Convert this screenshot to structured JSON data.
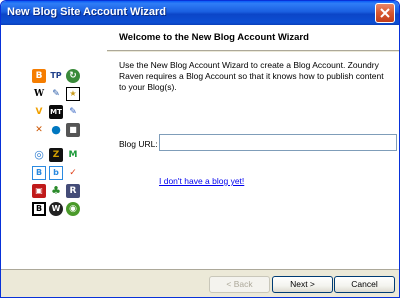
{
  "window": {
    "title": "New Blog Site Account Wizard",
    "close_icon": "close-icon"
  },
  "header": {
    "title": "Welcome to the New Blog Account Wizard"
  },
  "main": {
    "description": "Use the New Blog Account Wizard to create a Blog Account.  Zoundry Raven requires a Blog Account so that it knows how to publish content to your Blog(s).",
    "url_label": "Blog URL:",
    "url_value": "",
    "no_blog_link": "I don't have a blog yet!"
  },
  "footer": {
    "back_label": "< Back",
    "next_label": "Next >",
    "cancel_label": "Cancel"
  },
  "service_icons": [
    {
      "name": "blogger-icon",
      "glyph": "B",
      "color": "#f57d00"
    },
    {
      "name": "typepad-icon",
      "glyph": "TP",
      "color": "#1e3f8a"
    },
    {
      "name": "refresh-icon",
      "glyph": "↻",
      "color": "#3a8a3a"
    },
    {
      "name": "wordpress-w-icon",
      "glyph": "W",
      "color": "#000000"
    },
    {
      "name": "pen-icon",
      "glyph": "✎",
      "color": "#2a5ca8"
    },
    {
      "name": "star-icon",
      "glyph": "★",
      "color": "#c89a1a"
    },
    {
      "name": "v-icon",
      "glyph": "V",
      "color": "#f0a000"
    },
    {
      "name": "movable-type-icon",
      "glyph": "MT",
      "color": "#0a0a0a"
    },
    {
      "name": "pencil-icon",
      "glyph": "✎",
      "color": "#3060c0"
    },
    {
      "name": "tools-icon",
      "glyph": "✕",
      "color": "#cc5500"
    },
    {
      "name": "drupal-icon",
      "glyph": "●",
      "color": "#0077c0"
    },
    {
      "name": "square-icon",
      "glyph": "■",
      "color": "#555555"
    },
    {
      "name": "globe-icon",
      "glyph": "◎",
      "color": "#2a7ad0"
    },
    {
      "name": "z-icon",
      "glyph": "Z",
      "color": "#d4a000"
    },
    {
      "name": "m-icon",
      "glyph": "M",
      "color": "#1d9a3a"
    },
    {
      "name": "b-icon",
      "glyph": "B",
      "color": "#2a8ae0"
    },
    {
      "name": "dash-icon",
      "glyph": "b",
      "color": "#2a8ae0"
    },
    {
      "name": "check-icon",
      "glyph": "✓",
      "color": "#e0401a"
    },
    {
      "name": "red-book-icon",
      "glyph": "▣",
      "color": "#c01a1a"
    },
    {
      "name": "tree-icon",
      "glyph": "♣",
      "color": "#2a8a2a"
    },
    {
      "name": "r-icon",
      "glyph": "R",
      "color": "#444c78"
    },
    {
      "name": "b-black-icon",
      "glyph": "B",
      "color": "#000000"
    },
    {
      "name": "wordpress-icon",
      "glyph": "W",
      "color": "#222222"
    },
    {
      "name": "swirl-icon",
      "glyph": "◉",
      "color": "#4a9a2a"
    }
  ]
}
